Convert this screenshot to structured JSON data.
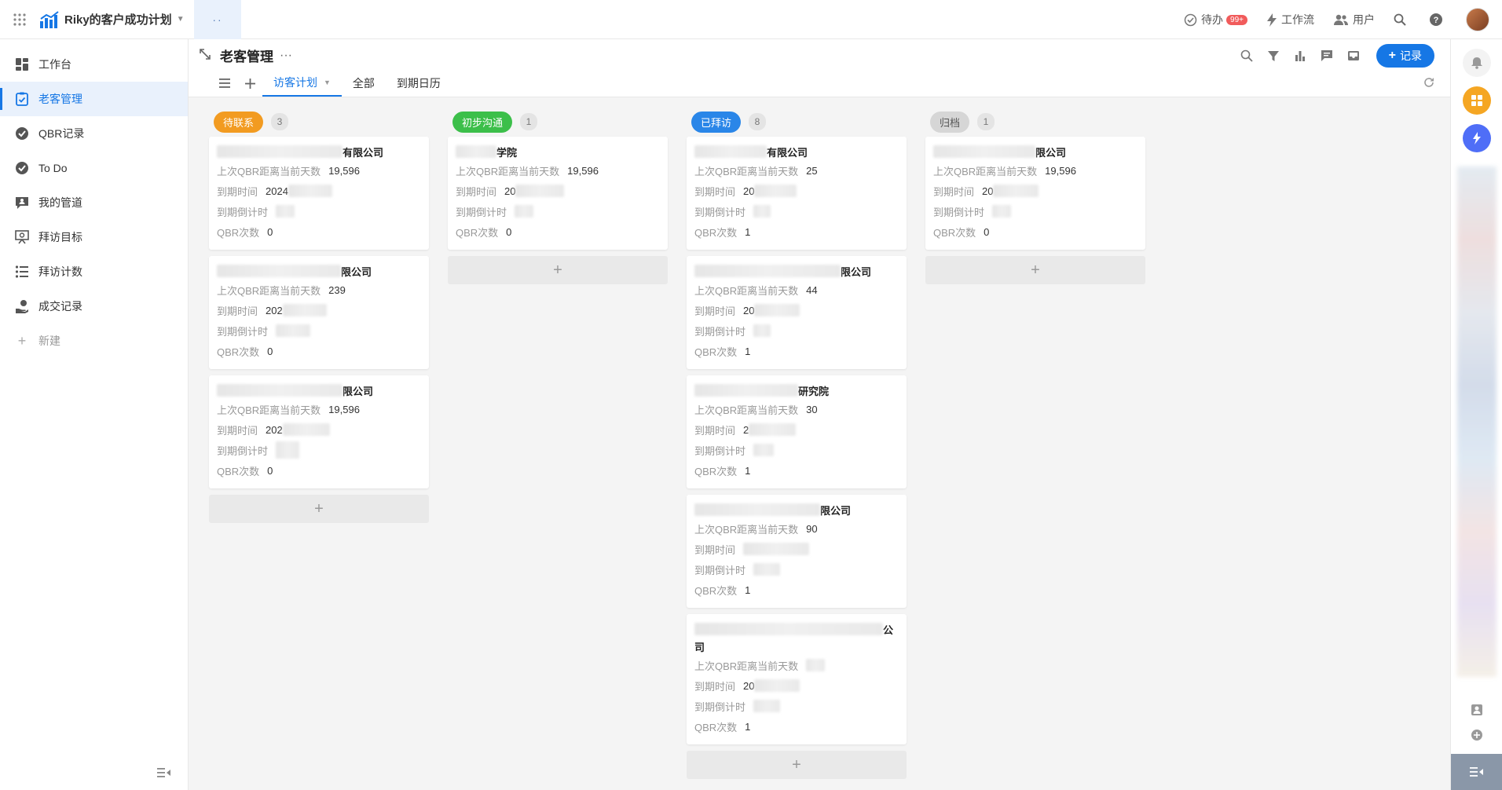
{
  "topbar": {
    "app_title": "Riky的客户成功计划",
    "dots": "··",
    "todo_label": "待办",
    "todo_badge": "99+",
    "workflow_label": "工作流",
    "users_label": "用户"
  },
  "sidebar": {
    "items": [
      {
        "label": "工作台",
        "icon": "dashboard-icon"
      },
      {
        "label": "老客管理",
        "icon": "checklist-icon"
      },
      {
        "label": "QBR记录",
        "icon": "check-circle-icon"
      },
      {
        "label": "To Do",
        "icon": "check-circle-icon"
      },
      {
        "label": "我的管道",
        "icon": "person-chat-icon"
      },
      {
        "label": "拜访目标",
        "icon": "easel-icon"
      },
      {
        "label": "拜访计数",
        "icon": "list-icon"
      },
      {
        "label": "成交记录",
        "icon": "hand-coin-icon"
      }
    ],
    "new_label": "新建"
  },
  "main": {
    "title": "老客管理",
    "more": "···",
    "add_record": "记录",
    "tabs": [
      "访客计划",
      "全部",
      "到期日历"
    ]
  },
  "colors": {
    "accent": "#1677e5",
    "orange": "#f29b21",
    "green": "#3cbf4a",
    "blue": "#2a86e8",
    "gray": "#d6d6d6"
  },
  "labels": {
    "days": "上次QBR距离当前天数",
    "due": "到期时间",
    "countdown": "到期倒计时",
    "qbr_count": "QBR次数",
    "add": "+"
  },
  "columns": [
    {
      "name": "待联系",
      "count": "3",
      "cards": [
        {
          "title_suffix": "有限公司",
          "days": "19,596",
          "due": "2024",
          "qbr": "0"
        },
        {
          "title_suffix": "限公司",
          "days": "239",
          "due": "202",
          "qbr": "0"
        },
        {
          "title_suffix": "限公司",
          "days": "19,596",
          "due": "202",
          "qbr": "0"
        }
      ]
    },
    {
      "name": "初步沟通",
      "count": "1",
      "cards": [
        {
          "title_suffix": "学院",
          "days": "19,596",
          "due": "20",
          "qbr": "0"
        }
      ]
    },
    {
      "name": "已拜访",
      "count": "8",
      "cards": [
        {
          "title_suffix": "有限公司",
          "days": "25",
          "due": "20",
          "qbr": "1"
        },
        {
          "title_suffix": "限公司",
          "days": "44",
          "due": "20",
          "qbr": "1"
        },
        {
          "title_suffix": "研究院",
          "days": "30",
          "due": "2",
          "qbr": "1"
        },
        {
          "title_suffix": "限公司",
          "days": "90",
          "due": "",
          "qbr": "1"
        },
        {
          "title_suffix": "公",
          "title_line2": "司",
          "days": "",
          "due": "20",
          "qbr": "1"
        }
      ]
    },
    {
      "name": "归档",
      "count": "1",
      "cards": [
        {
          "title_suffix": "限公司",
          "days": "19,596",
          "due": "20",
          "qbr": "0"
        }
      ]
    }
  ]
}
